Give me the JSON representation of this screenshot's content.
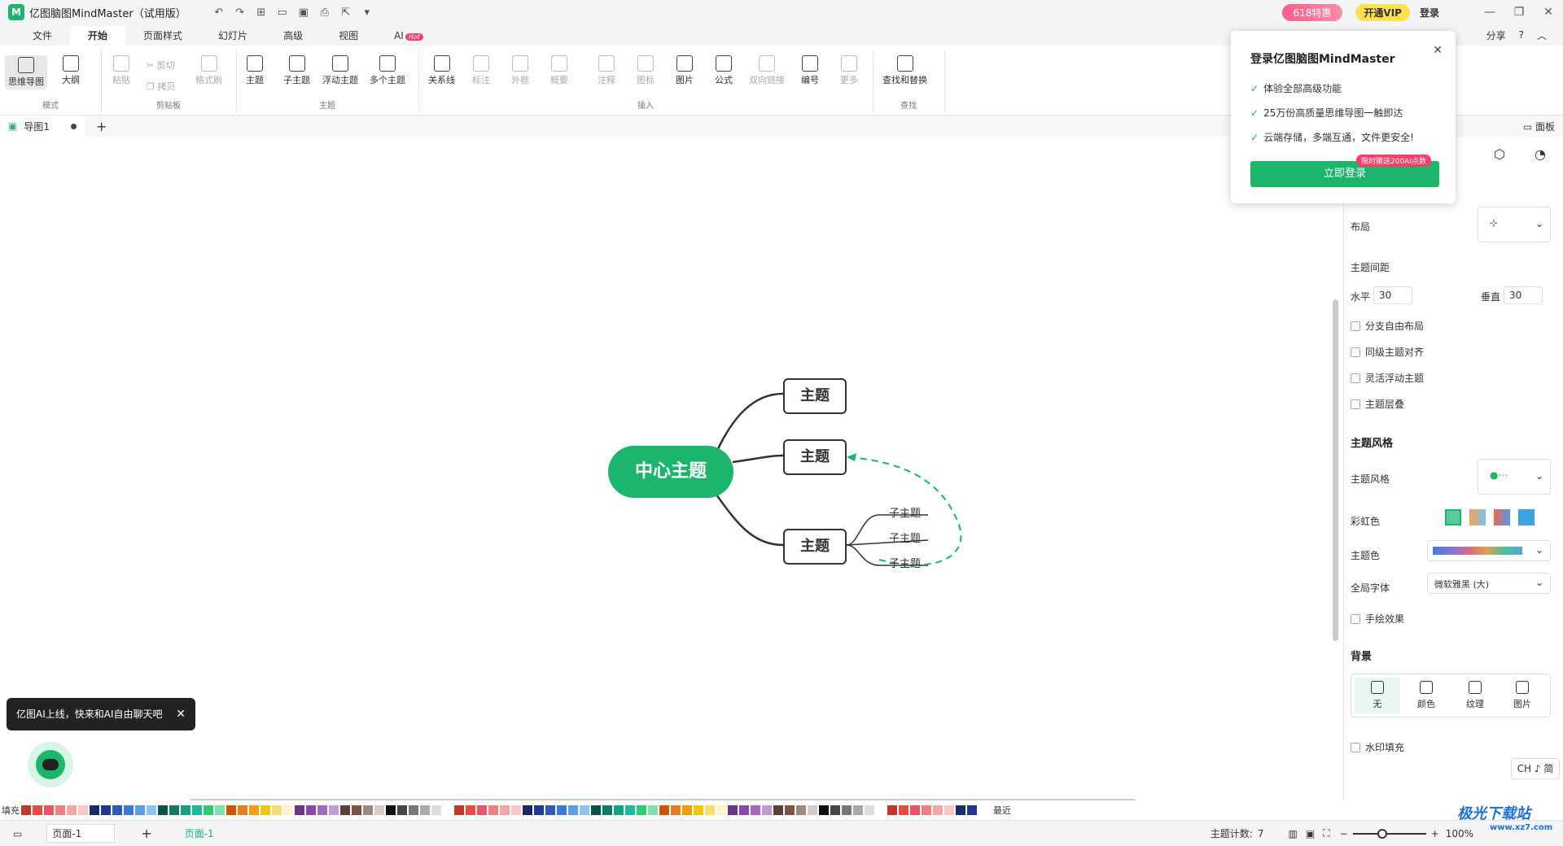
{
  "app": {
    "title": "亿图脑图MindMaster（试用版）",
    "logo": "M"
  },
  "titlebar": {
    "promo": "618特惠",
    "vip": "开通VIP",
    "login": "登录"
  },
  "menu": {
    "items": [
      "文件",
      "开始",
      "页面样式",
      "幻灯片",
      "高级",
      "视图",
      "AI"
    ],
    "ai_badge": "Hot",
    "share": "分享",
    "help": "?"
  },
  "ribbon": {
    "mode": {
      "label": "模式",
      "mindmap": "思维导图",
      "outline": "大纲"
    },
    "clipboard": {
      "label": "剪贴板",
      "paste": "粘贴",
      "cut": "剪切",
      "copy": "拷贝",
      "format": "格式刷"
    },
    "topic": {
      "label": "主题",
      "topic": "主题",
      "subtopic": "子主题",
      "floating": "浮动主题",
      "multi": "多个主题"
    },
    "insert": {
      "label": "插入",
      "relation": "关系线",
      "callout": "标注",
      "boundary": "外框",
      "summary": "概要",
      "note": "注释",
      "icon": "图标",
      "image": "图片",
      "formula": "公式",
      "link": "双向链接",
      "numbering": "编号",
      "more": "更多"
    },
    "find": {
      "label": "查找",
      "find_replace": "查找和替换"
    }
  },
  "tabs": {
    "doc": "导图1",
    "panel": "面板"
  },
  "mindmap": {
    "center": "中心主题",
    "topics": [
      "主题",
      "主题",
      "主题"
    ],
    "subtopics": [
      "子主题",
      "子主题",
      "子主题"
    ]
  },
  "ai": {
    "tip": "亿图AI上线，快来和AI自由聊天吧"
  },
  "popup": {
    "title": "登录亿图脑图MindMaster",
    "features": [
      "体验全部高级功能",
      "25万份高质量思维导图一触即达",
      "云端存储，多端互通，文件更安全!"
    ],
    "badge": "限时赠送200AI点数",
    "button": "立即登录"
  },
  "panel": {
    "layout": "布局",
    "spacing": "主题间距",
    "horizontal_label": "水平",
    "horizontal": "30",
    "vertical_label": "垂直",
    "vertical": "30",
    "checks": [
      "分支自由布局",
      "同级主题对齐",
      "灵活浮动主题",
      "主题层叠"
    ],
    "style_header": "主题风格",
    "style_label": "主题风格",
    "rainbow": "彩虹色",
    "theme_color": "主题色",
    "font_label": "全局字体",
    "font_value": "微软雅黑 (大)",
    "hand_drawn": "手绘效果",
    "background": "背景",
    "bg_options": [
      "无",
      "颜色",
      "纹理",
      "图片"
    ],
    "watermark": "水印填充"
  },
  "palette": {
    "label": "填充",
    "recent": "最近"
  },
  "status": {
    "page_select": "页面-1",
    "page_tab": "页面-1",
    "topic_count_label": "主题计数:",
    "topic_count": "7",
    "zoom": "100%"
  },
  "ime": "CH ♪ 简",
  "brand_watermark": {
    "name": "极光下载站",
    "url": "www.xz7.com"
  },
  "colors": {
    "accent": "#1bb56b",
    "relation": "#1bb56b"
  }
}
